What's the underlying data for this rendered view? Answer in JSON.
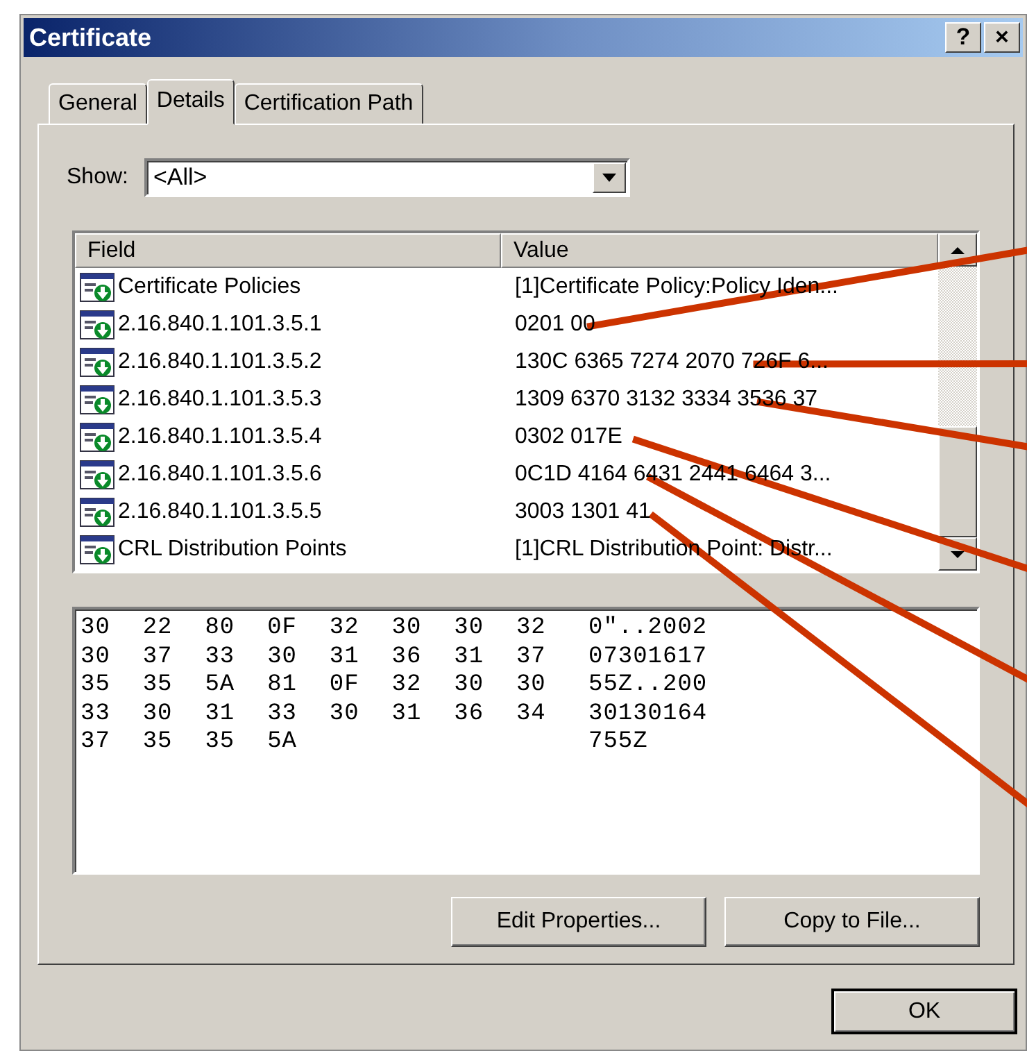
{
  "window": {
    "title": "Certificate",
    "help_button": "?",
    "close_button": "×"
  },
  "tabs": [
    {
      "label": "General",
      "selected": false
    },
    {
      "label": "Details",
      "selected": true
    },
    {
      "label": "Certification Path",
      "selected": false
    }
  ],
  "show": {
    "label": "Show:",
    "value": "<All>"
  },
  "table": {
    "columns": [
      "Field",
      "Value"
    ],
    "rows": [
      {
        "field": "Certificate Policies",
        "value": "[1]Certificate Policy:Policy Iden...",
        "callout": false
      },
      {
        "field": "2.16.840.1.101.3.5.1",
        "value": "0201 00",
        "callout": true
      },
      {
        "field": "2.16.840.1.101.3.5.2",
        "value": "130C 6365 7274 2070 726F 6...",
        "callout": true
      },
      {
        "field": "2.16.840.1.101.3.5.3",
        "value": "1309 6370 3132 3334 3536 37",
        "callout": true
      },
      {
        "field": "2.16.840.1.101.3.5.4",
        "value": "0302 017E",
        "callout": true
      },
      {
        "field": "2.16.840.1.101.3.5.6",
        "value": "0C1D 4164 6431 2441 6464 3...",
        "callout": true
      },
      {
        "field": "2.16.840.1.101.3.5.5",
        "value": "3003 1301 41",
        "callout": true
      },
      {
        "field": "CRL Distribution Points",
        "value": "[1]CRL Distribution Point: Distr...",
        "callout": false
      }
    ]
  },
  "hex_dump": [
    {
      "bytes": "30 22 80 0F 32 30 30 32",
      "ascii": "0\"..2002"
    },
    {
      "bytes": "30 37 33 30 31 36 31 37",
      "ascii": "07301617"
    },
    {
      "bytes": "35 35 5A 81 0F 32 30 30",
      "ascii": "55Z..200"
    },
    {
      "bytes": "33 30 31 33 30 31 36 34",
      "ascii": "30130164"
    },
    {
      "bytes": "37 35 35 5A",
      "ascii": "755Z"
    }
  ],
  "buttons": [
    "Edit Properties...",
    "Copy to File..."
  ],
  "ok_button": "OK"
}
